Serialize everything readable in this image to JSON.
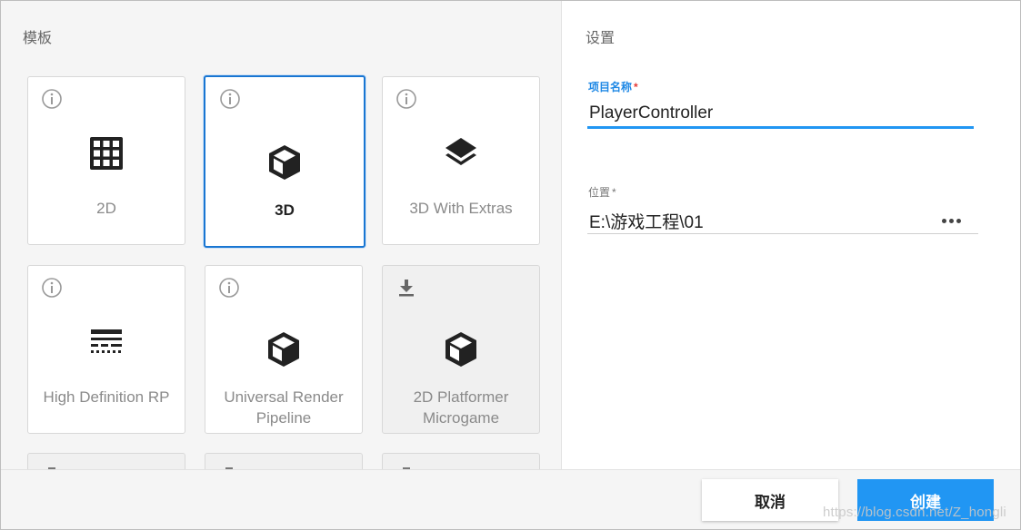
{
  "templates": {
    "title": "模板",
    "cards": [
      {
        "label": "2D",
        "icon": "grid-icon",
        "corner": "info-icon",
        "state": "normal"
      },
      {
        "label": "3D",
        "icon": "cube-icon",
        "corner": "info-icon",
        "state": "selected"
      },
      {
        "label": "3D With Extras",
        "icon": "layers-icon",
        "corner": "info-icon",
        "state": "normal"
      },
      {
        "label": "High Definition RP",
        "icon": "hdrp-lines-icon",
        "corner": "info-icon",
        "state": "normal"
      },
      {
        "label": "Universal Render Pipeline",
        "icon": "cube-icon",
        "corner": "info-icon",
        "state": "normal"
      },
      {
        "label": "2D Platformer Microgame",
        "icon": "cube-icon",
        "corner": "download-icon",
        "state": "download"
      }
    ]
  },
  "settings": {
    "title": "设置",
    "project_name": {
      "label": "项目名称",
      "required_mark": "*",
      "value": "PlayerController"
    },
    "location": {
      "label": "位置",
      "required_mark": "*",
      "value": "E:\\游戏工程\\01"
    }
  },
  "buttons": {
    "cancel": "取消",
    "create": "创建"
  },
  "watermark": "https://blog.csdn.net/Z_hongli",
  "colors": {
    "accent": "#2196f3",
    "selected_border": "#1976d2",
    "required": "#e53935"
  }
}
